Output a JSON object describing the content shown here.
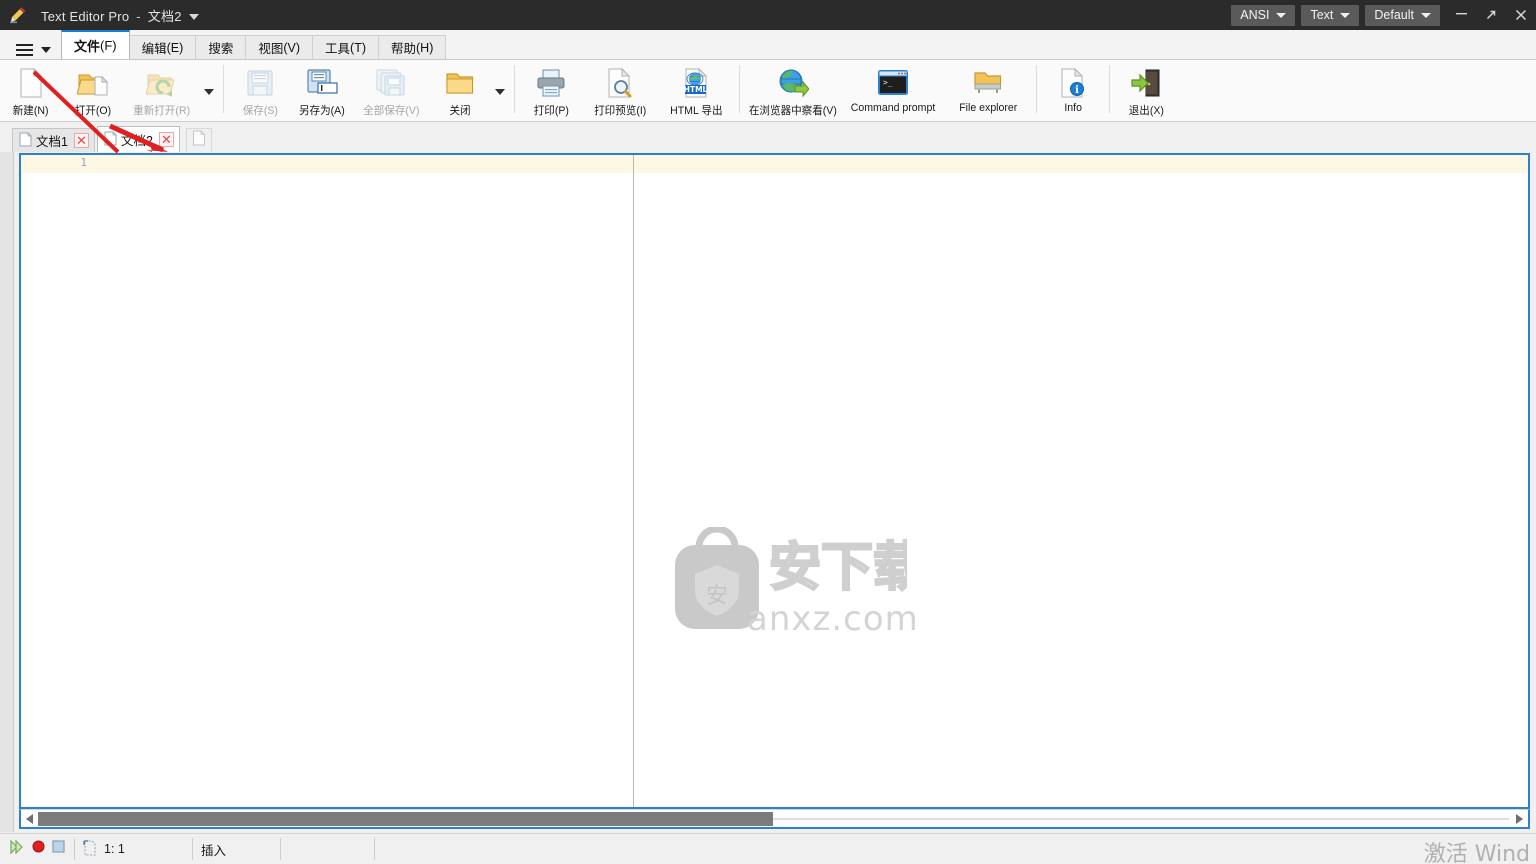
{
  "window": {
    "app_name": "Text Editor Pro",
    "separator": "-",
    "document_name": "文档2",
    "app_icon": "pencil-icon",
    "chips": [
      {
        "label": "ANSI",
        "name": "encoding-selector"
      },
      {
        "label": "Text",
        "name": "syntax-selector"
      },
      {
        "label": "Default",
        "name": "profile-selector"
      }
    ],
    "controls": {
      "minimize": "—",
      "restore": "↗",
      "close": "✕"
    }
  },
  "menubar": {
    "burger_label": "main-menu",
    "tabs": [
      {
        "label": "文件",
        "key": "(F)",
        "active": true
      },
      {
        "label": "编辑",
        "key": "(E)",
        "active": false
      },
      {
        "label": "搜索",
        "key": "",
        "active": false
      },
      {
        "label": "视图",
        "key": "(V)",
        "active": false
      },
      {
        "label": "工具",
        "key": "(T)",
        "active": false
      },
      {
        "label": "帮助",
        "key": "(H)",
        "active": false
      }
    ]
  },
  "ribbon": {
    "groups": [
      {
        "items": [
          {
            "label": "新建(N)",
            "icon": "new-document-icon",
            "disabled": false
          },
          {
            "label": "打开(O)",
            "icon": "open-folder-icon",
            "disabled": false
          },
          {
            "label": "重新打开(R)",
            "icon": "reopen-folder-icon",
            "disabled": true
          }
        ],
        "caret": true
      },
      {
        "items": [
          {
            "label": "保存(S)",
            "icon": "save-disk-icon",
            "disabled": true
          },
          {
            "label": "另存为(A)",
            "icon": "save-as-icon",
            "disabled": false
          },
          {
            "label": "全部保存(V)",
            "icon": "save-all-icon",
            "disabled": true
          },
          {
            "label": "关闭",
            "icon": "close-folder-icon",
            "disabled": false
          }
        ],
        "caret": true
      },
      {
        "items": [
          {
            "label": "打印(P)",
            "icon": "printer-icon",
            "disabled": false
          },
          {
            "label": "打印预览(I)",
            "icon": "print-preview-icon",
            "disabled": false
          },
          {
            "label": "HTML 导出",
            "icon": "html-export-icon",
            "disabled": false
          }
        ],
        "caret": false
      },
      {
        "items": [
          {
            "label": "在浏览器中察看(V)",
            "icon": "globe-browser-icon",
            "disabled": false
          },
          {
            "label": "Command prompt",
            "icon": "console-icon",
            "disabled": false
          },
          {
            "label": "File explorer",
            "icon": "file-explorer-icon",
            "disabled": false
          }
        ],
        "caret": false
      },
      {
        "items": [
          {
            "label": "Info",
            "icon": "info-document-icon",
            "disabled": false
          }
        ],
        "caret": false
      },
      {
        "items": [
          {
            "label": "退出(X)",
            "icon": "exit-door-icon",
            "disabled": false
          }
        ],
        "caret": false
      }
    ]
  },
  "doctabs": {
    "tabs": [
      {
        "label": "文档1",
        "active": false,
        "close": "✕"
      },
      {
        "label": "文档2",
        "active": true,
        "close": "✕"
      }
    ],
    "new_tab_icon": "new-document-tab-icon"
  },
  "editor": {
    "line_number": "1",
    "content": "",
    "watermark_text": "anxz.com",
    "watermark_glyph": "安下载",
    "watermark_badge": "安"
  },
  "scrollbar": {
    "left_arrow": "◀",
    "right_arrow": "▶"
  },
  "statusbar": {
    "icons": [
      {
        "name": "play-macro-icon"
      },
      {
        "name": "record-macro-icon"
      },
      {
        "name": "stop-macro-icon"
      }
    ],
    "position": "1: 1",
    "mode": "插入",
    "cell4": "",
    "cell5": ""
  },
  "overlay": {
    "windows_activation": "激活 Wind"
  },
  "colors": {
    "titlebar_bg": "#2b2b2b",
    "accent_blue": "#2f7fd0",
    "tab_accent": "#1a7fd4",
    "current_line": "#fdf8e4",
    "annotation_red": "#e02020",
    "close_red": "#e24a4a"
  }
}
